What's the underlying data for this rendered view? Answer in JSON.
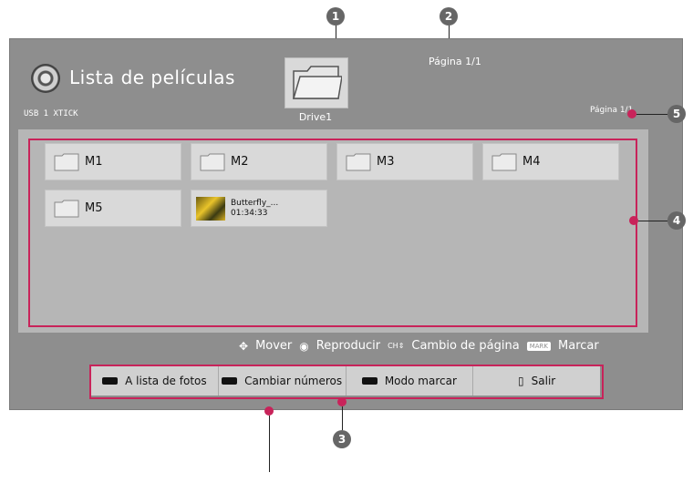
{
  "header": {
    "title": "Lista de películas",
    "usb_label": "USB 1 XTICK",
    "drive_label": "Drive1",
    "page_top": "Página 1/1",
    "page_right": "Página 1/1"
  },
  "items": [
    {
      "label": "M1",
      "type": "folder"
    },
    {
      "label": "M2",
      "type": "folder"
    },
    {
      "label": "M3",
      "type": "folder"
    },
    {
      "label": "M4",
      "type": "folder"
    },
    {
      "label": "M5",
      "type": "folder"
    },
    {
      "label": "Butterfly_...",
      "duration": "01:34:33",
      "type": "movie"
    }
  ],
  "legend": {
    "move": "Mover",
    "play": "Reproducir",
    "ch_label": "CH",
    "page_change": "Cambio de página",
    "mark_label": "MARK",
    "mark": "Marcar"
  },
  "buttons": {
    "photos": "A lista de fotos",
    "numbers": "Cambiar números",
    "mark_mode": "Modo marcar",
    "exit": "Salir"
  },
  "callouts": {
    "c1": "1",
    "c2": "2",
    "c3": "3",
    "c4": "4",
    "c5": "5"
  },
  "colors": {
    "accent": "#c8235a",
    "screen_bg": "#8e8e8e",
    "tile_bg": "#d9d9d9"
  }
}
